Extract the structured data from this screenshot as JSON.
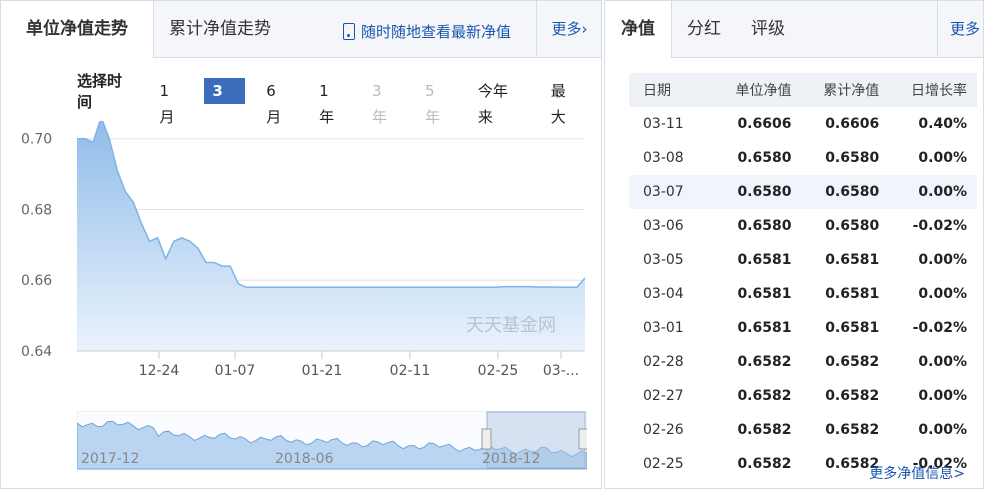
{
  "left_tabs": {
    "tab1": "单位净值走势",
    "tab2": "累计净值走势",
    "promo": "随时随地查看最新净值",
    "more": "更多›"
  },
  "period": {
    "label": "选择时间",
    "options": [
      "1月",
      "3月",
      "6月",
      "1年",
      "3年",
      "5年",
      "今年来",
      "最大"
    ],
    "active": "3月",
    "disabled": [
      "3年",
      "5年"
    ]
  },
  "watermark": "天天基金网",
  "chart_data": {
    "type": "area",
    "ylim": [
      0.64,
      0.705
    ],
    "yticks": [
      "0.70",
      "0.68",
      "0.66",
      "0.64"
    ],
    "ytick_values": [
      0.7,
      0.68,
      0.66,
      0.64
    ],
    "xticks": [
      "12-24",
      "01-07",
      "01-21",
      "02-11",
      "02-25",
      "03-..."
    ],
    "series": [
      {
        "values": [
          0.7,
          0.7,
          0.699,
          0.706,
          0.7,
          0.691,
          0.685,
          0.682,
          0.676,
          0.671,
          0.672,
          0.666,
          0.671,
          0.672,
          0.671,
          0.669,
          0.665,
          0.665,
          0.664,
          0.664,
          0.659,
          0.658,
          0.658,
          0.658,
          0.658,
          0.658,
          0.658,
          0.658,
          0.658,
          0.658,
          0.658,
          0.658,
          0.658,
          0.658,
          0.658,
          0.658,
          0.658,
          0.658,
          0.658,
          0.658,
          0.658,
          0.658,
          0.658,
          0.658,
          0.658,
          0.658,
          0.658,
          0.658,
          0.658,
          0.658,
          0.658,
          0.658,
          0.658,
          0.6582,
          0.6582,
          0.6582,
          0.6582,
          0.6581,
          0.6581,
          0.6581,
          0.658,
          0.658,
          0.658,
          0.6606
        ]
      }
    ],
    "navigator": {
      "labels": [
        "2017-12",
        "2018-06",
        "2018-12"
      ]
    }
  },
  "right_tabs": {
    "tab1": "净值",
    "tab2": "分红",
    "tab3": "评级",
    "more": "更多"
  },
  "table": {
    "headers": [
      "日期",
      "单位净值",
      "累计净值",
      "日增长率"
    ],
    "rows": [
      [
        "03-11",
        "0.6606",
        "0.6606",
        "0.40%"
      ],
      [
        "03-08",
        "0.6580",
        "0.6580",
        "0.00%"
      ],
      [
        "03-07",
        "0.6580",
        "0.6580",
        "0.00%"
      ],
      [
        "03-06",
        "0.6580",
        "0.6580",
        "-0.02%"
      ],
      [
        "03-05",
        "0.6581",
        "0.6581",
        "0.00%"
      ],
      [
        "03-04",
        "0.6581",
        "0.6581",
        "0.00%"
      ],
      [
        "03-01",
        "0.6581",
        "0.6581",
        "-0.02%"
      ],
      [
        "02-28",
        "0.6582",
        "0.6582",
        "0.00%"
      ],
      [
        "02-27",
        "0.6582",
        "0.6582",
        "0.00%"
      ],
      [
        "02-26",
        "0.6582",
        "0.6582",
        "0.00%"
      ],
      [
        "02-25",
        "0.6582",
        "0.6582",
        "-0.02%"
      ]
    ],
    "more": "更多净值信息>"
  },
  "colors": {
    "accent": "#3a6ebd",
    "link": "#1a56b0",
    "line": "#7fb2e8",
    "up": "#e00000",
    "down": "#1a9b1a"
  }
}
